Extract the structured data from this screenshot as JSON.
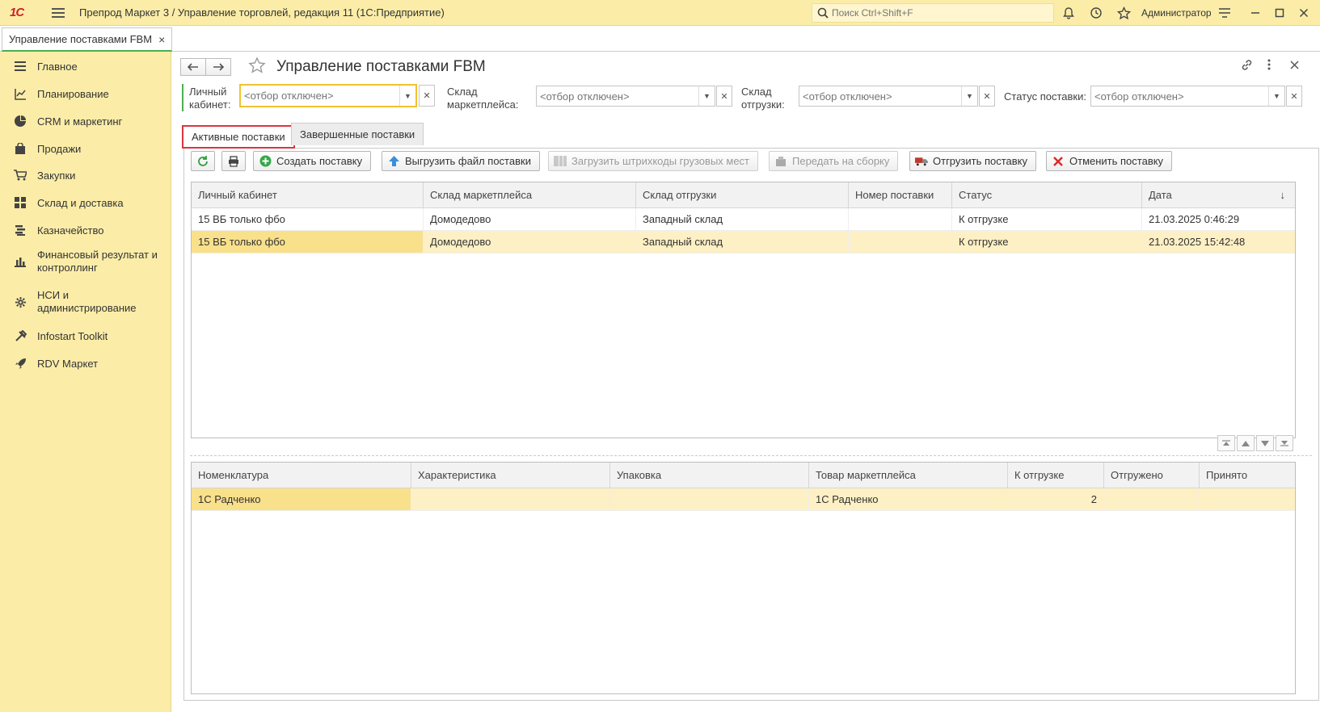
{
  "app": {
    "logo": "1С",
    "title": "Препрод Маркет 3 / Управление торговлей, редакция 11  (1С:Предприятие)",
    "search_placeholder": "Поиск Ctrl+Shift+F",
    "user": "Администратор"
  },
  "open_tab": {
    "label": "Управление поставками FBM",
    "close": "×"
  },
  "sidebar": {
    "items": [
      {
        "label": "Главное",
        "icon": "menu-icon"
      },
      {
        "label": "Планирование",
        "icon": "chart-line-icon"
      },
      {
        "label": "CRM и маркетинг",
        "icon": "pie-chart-icon"
      },
      {
        "label": "Продажи",
        "icon": "shopping-bag-icon"
      },
      {
        "label": "Закупки",
        "icon": "cart-icon"
      },
      {
        "label": "Склад и доставка",
        "icon": "grid-icon"
      },
      {
        "label": "Казначейство",
        "icon": "coins-icon"
      },
      {
        "label": "Финансовый результат и контроллинг",
        "icon": "bar-chart-icon"
      },
      {
        "label": "НСИ и администрирование",
        "icon": "gear-icon"
      },
      {
        "label": "Infostart Toolkit",
        "icon": "tools-icon"
      },
      {
        "label": "RDV Маркет",
        "icon": "rocket-icon"
      }
    ]
  },
  "form": {
    "title": "Управление поставками FBM",
    "filters": [
      {
        "label": "Личный кабинет:",
        "placeholder": "<отбор отключен>"
      },
      {
        "label": "Склад маркетплейса:",
        "placeholder": "<отбор отключен>"
      },
      {
        "label": "Склад отгрузки:",
        "placeholder": "<отбор отключен>"
      },
      {
        "label": "Статус поставки:",
        "placeholder": "<отбор отключен>"
      }
    ],
    "tabs": [
      {
        "label": "Активные поставки"
      },
      {
        "label": "Завершенные поставки"
      }
    ],
    "toolbar": {
      "create": "Создать поставку",
      "export": "Выгрузить файл поставки",
      "load_barcodes": "Загрузить штрихкоды грузовых мест",
      "send_assembly": "Передать на сборку",
      "ship": "Отгрузить поставку",
      "cancel": "Отменить поставку"
    },
    "supplies": {
      "columns": [
        "Личный кабинет",
        "Склад маркетплейса",
        "Склад отгрузки",
        "Номер поставки",
        "Статус",
        "Дата"
      ],
      "sort_indicator": "↓",
      "rows": [
        [
          "15 ВБ только фбо",
          "Домодедово",
          "Западный склад",
          "",
          "К отгрузке",
          "21.03.2025 0:46:29"
        ],
        [
          "15 ВБ только фбо",
          "Домодедово",
          "Западный склад",
          "",
          "К отгрузке",
          "21.03.2025 15:42:48"
        ]
      ]
    },
    "items": {
      "columns": [
        "Номенклатура",
        "Характеристика",
        "Упаковка",
        "Товар маркетплейса",
        "К отгрузке",
        "Отгружено",
        "Принято"
      ],
      "rows": [
        [
          "1С Радченко",
          "",
          "",
          "1С Радченко",
          "2",
          "",
          ""
        ]
      ]
    }
  }
}
